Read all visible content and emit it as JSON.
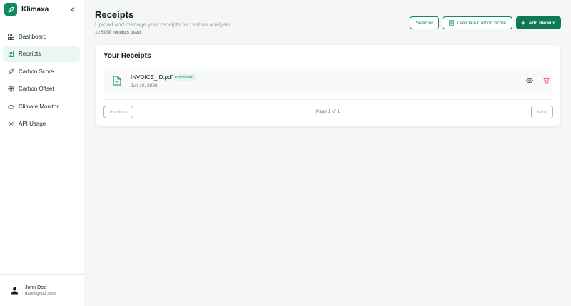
{
  "app": {
    "name": "Klimaxa",
    "accent": "#0e8a63"
  },
  "sidebar": {
    "items": [
      {
        "label": "Dashboard",
        "icon": "grid-icon",
        "active": false
      },
      {
        "label": "Receipts",
        "icon": "receipt-icon",
        "active": true
      },
      {
        "label": "Carbon Score",
        "icon": "leaf-icon",
        "active": false
      },
      {
        "label": "Carbon Offset",
        "icon": "globe-icon",
        "active": false
      },
      {
        "label": "Climate Monitor",
        "icon": "cloud-icon",
        "active": false
      },
      {
        "label": "API Usage",
        "icon": "gear-icon",
        "active": false
      }
    ],
    "user": {
      "name": "John Doe",
      "email": "dao@gmail.com"
    }
  },
  "header": {
    "title": "Receipts",
    "subtitle": "Upload and manage your receipts for carbon analysis",
    "usage": "1 / 5000 receipts used",
    "selector_label": "Selector",
    "calc_label": "Calculate Carbon Score",
    "add_label": "Add Receipt"
  },
  "receipts_card": {
    "title": "Your Receipts",
    "items": [
      {
        "filename": "INVOICE_ID.pdf",
        "status": "Processed",
        "date": "Jun 10, 2026"
      }
    ],
    "pagination": {
      "prev": "Previous",
      "info": "Page 1 of 1",
      "next": "Next"
    }
  }
}
